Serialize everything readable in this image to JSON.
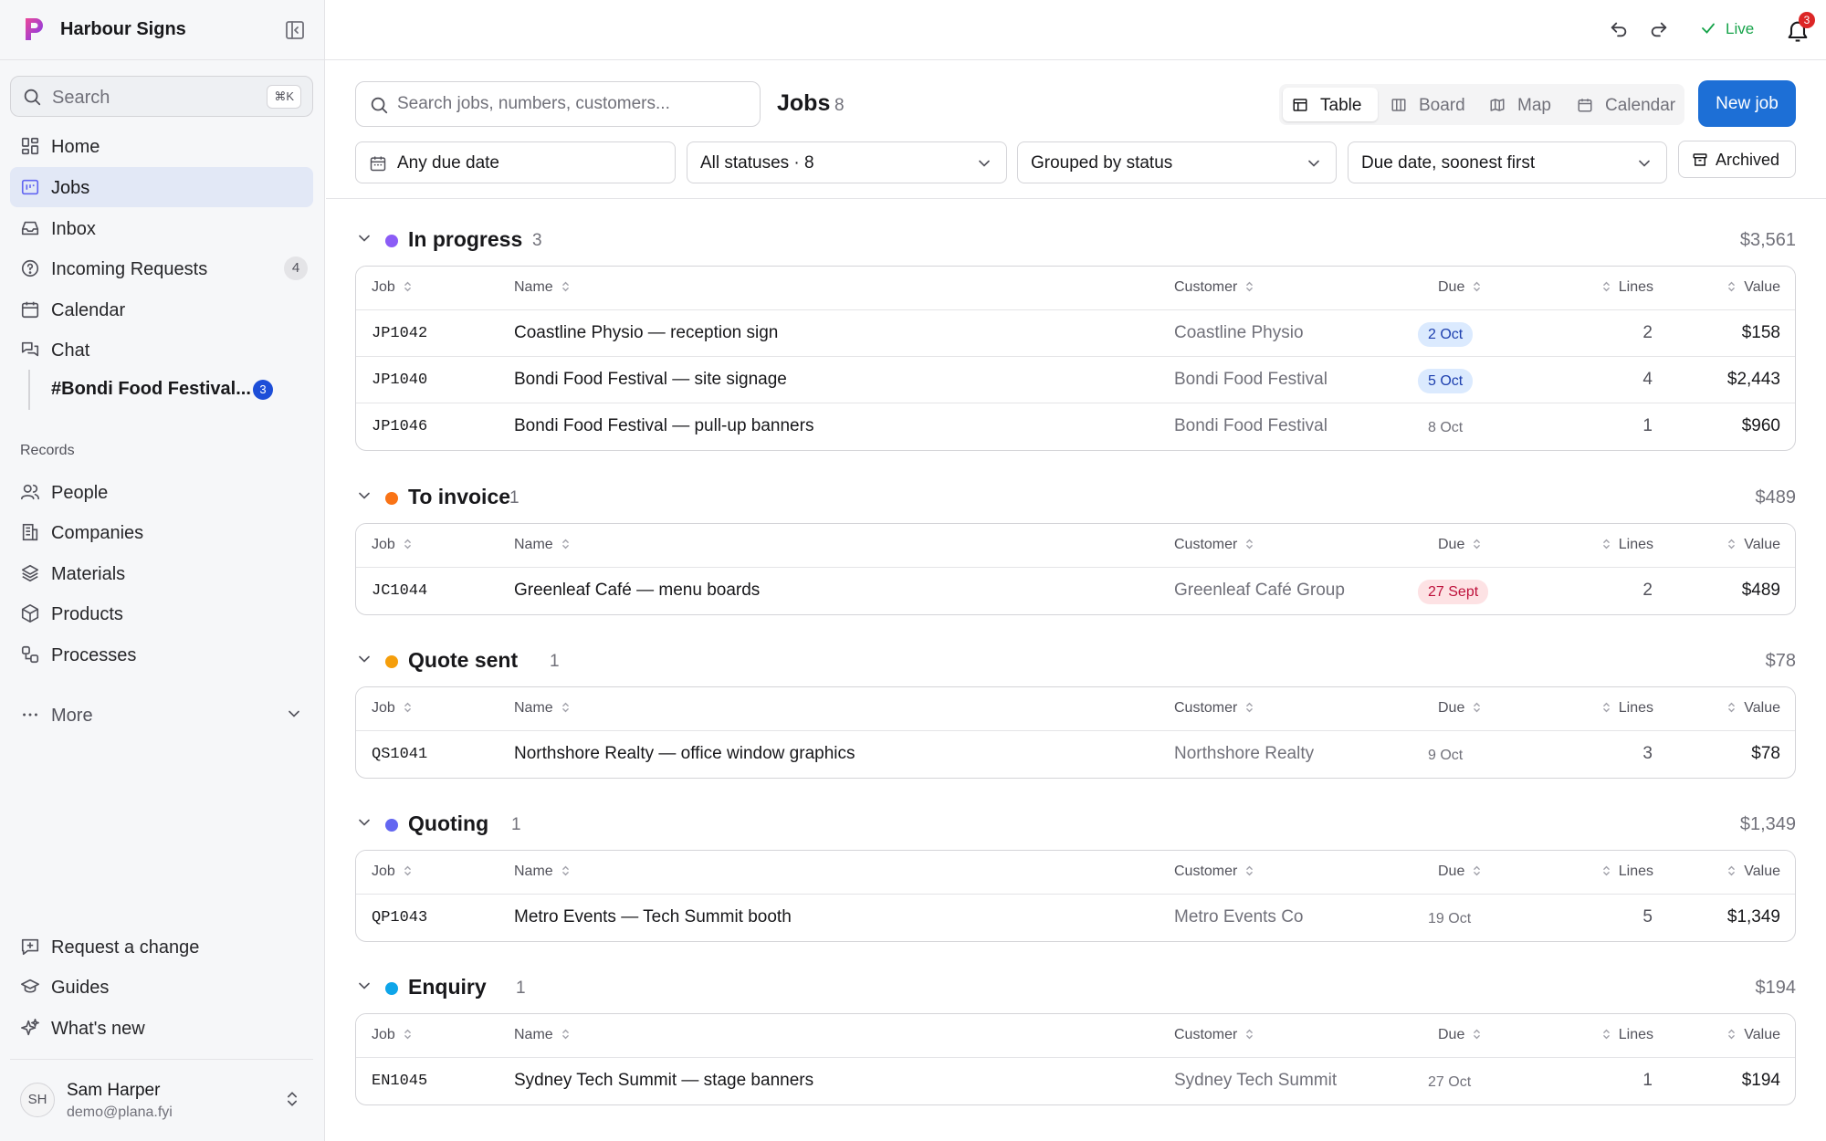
{
  "sidebar": {
    "app_title": "Harbour Signs",
    "search_label": "Search",
    "search_shortcut": "⌘K",
    "nav": [
      {
        "label": "Home",
        "icon": "home-grid-icon"
      },
      {
        "label": "Jobs",
        "icon": "jobs-icon",
        "active": true
      },
      {
        "label": "Inbox",
        "icon": "inbox-icon"
      },
      {
        "label": "Incoming Requests",
        "icon": "help-circle-icon",
        "count": "4"
      },
      {
        "label": "Calendar",
        "icon": "calendar-icon"
      },
      {
        "label": "Chat",
        "icon": "chat-icon"
      }
    ],
    "chat_channel": {
      "label": "#Bondi Food Festival...",
      "badge": "3"
    },
    "records_label": "Records",
    "records": [
      {
        "label": "People",
        "icon": "people-icon"
      },
      {
        "label": "Companies",
        "icon": "companies-icon"
      },
      {
        "label": "Materials",
        "icon": "layers-icon"
      },
      {
        "label": "Products",
        "icon": "box-icon"
      },
      {
        "label": "Processes",
        "icon": "processes-icon"
      }
    ],
    "more_label": "More",
    "footer_links": [
      {
        "label": "Request a change",
        "icon": "request-change-icon"
      },
      {
        "label": "Guides",
        "icon": "graduation-cap-icon"
      },
      {
        "label": "What's new",
        "icon": "sparkles-icon"
      }
    ],
    "user": {
      "initials": "SH",
      "name": "Sam Harper",
      "email": "demo@plana.fyi"
    }
  },
  "topbar": {
    "live_label": "Live",
    "notification_count": "3",
    "live_color": "#16a34a"
  },
  "toolbar": {
    "search_placeholder": "Search jobs, numbers, customers...",
    "title": "Jobs",
    "count": "8",
    "views": [
      {
        "label": "Table",
        "icon": "table-icon",
        "active": true
      },
      {
        "label": "Board",
        "icon": "board-icon"
      },
      {
        "label": "Map",
        "icon": "map-icon"
      },
      {
        "label": "Calendar",
        "icon": "calendar-icon"
      }
    ],
    "new_button": "New job",
    "filters": {
      "due": "Any due date",
      "status": "All statuses · 8",
      "group": "Grouped by status",
      "sort": "Due date, soonest first"
    },
    "archived_label": "Archived",
    "accent_color": "#1d6fd6"
  },
  "columns": {
    "job": "Job",
    "name": "Name",
    "customer": "Customer",
    "due": "Due",
    "lines": "Lines",
    "value": "Value"
  },
  "groups": [
    {
      "name": "In progress",
      "count": "3",
      "total": "$3,561",
      "color": "#8b5cf6",
      "rows": [
        {
          "job": "JP1042",
          "name": "Coastline Physio — reception sign",
          "customer": "Coastline Physio",
          "due": "2 Oct",
          "due_style": "soon",
          "lines": "2",
          "value": "$158"
        },
        {
          "job": "JP1040",
          "name": "Bondi Food Festival — site signage",
          "customer": "Bondi Food Festival",
          "due": "5 Oct",
          "due_style": "soon",
          "lines": "4",
          "value": "$2,443"
        },
        {
          "job": "JP1046",
          "name": "Bondi Food Festival — pull-up banners",
          "customer": "Bondi Food Festival",
          "due": "8 Oct",
          "due_style": "normal",
          "lines": "1",
          "value": "$960"
        }
      ]
    },
    {
      "name": "To invoice",
      "count": "1",
      "total": "$489",
      "color": "#f97316",
      "rows": [
        {
          "job": "JC1044",
          "name": "Greenleaf Café — menu boards",
          "customer": "Greenleaf Café Group",
          "due": "27 Sept",
          "due_style": "overdue",
          "lines": "2",
          "value": "$489"
        }
      ]
    },
    {
      "name": "Quote sent",
      "count": "1",
      "total": "$78",
      "color": "#f59e0b",
      "rows": [
        {
          "job": "QS1041",
          "name": "Northshore Realty — office window graphics",
          "customer": "Northshore Realty",
          "due": "9 Oct",
          "due_style": "normal",
          "lines": "3",
          "value": "$78"
        }
      ]
    },
    {
      "name": "Quoting",
      "count": "1",
      "total": "$1,349",
      "color": "#6366f1",
      "rows": [
        {
          "job": "QP1043",
          "name": "Metro Events — Tech Summit booth",
          "customer": "Metro Events Co",
          "due": "19 Oct",
          "due_style": "normal",
          "lines": "5",
          "value": "$1,349"
        }
      ]
    },
    {
      "name": "Enquiry",
      "count": "1",
      "total": "$194",
      "color": "#0ea5e9",
      "rows": [
        {
          "job": "EN1045",
          "name": "Sydney Tech Summit — stage banners",
          "customer": "Sydney Tech Summit",
          "due": "27 Oct",
          "due_style": "normal",
          "lines": "1",
          "value": "$194"
        }
      ]
    }
  ],
  "due_styles": {
    "soon": {
      "bg": "#dbeafe",
      "fg": "#1e40af"
    },
    "overdue": {
      "bg": "#fde2e4",
      "fg": "#be123c"
    },
    "normal": {
      "bg": "transparent",
      "fg": "#71717a"
    }
  }
}
